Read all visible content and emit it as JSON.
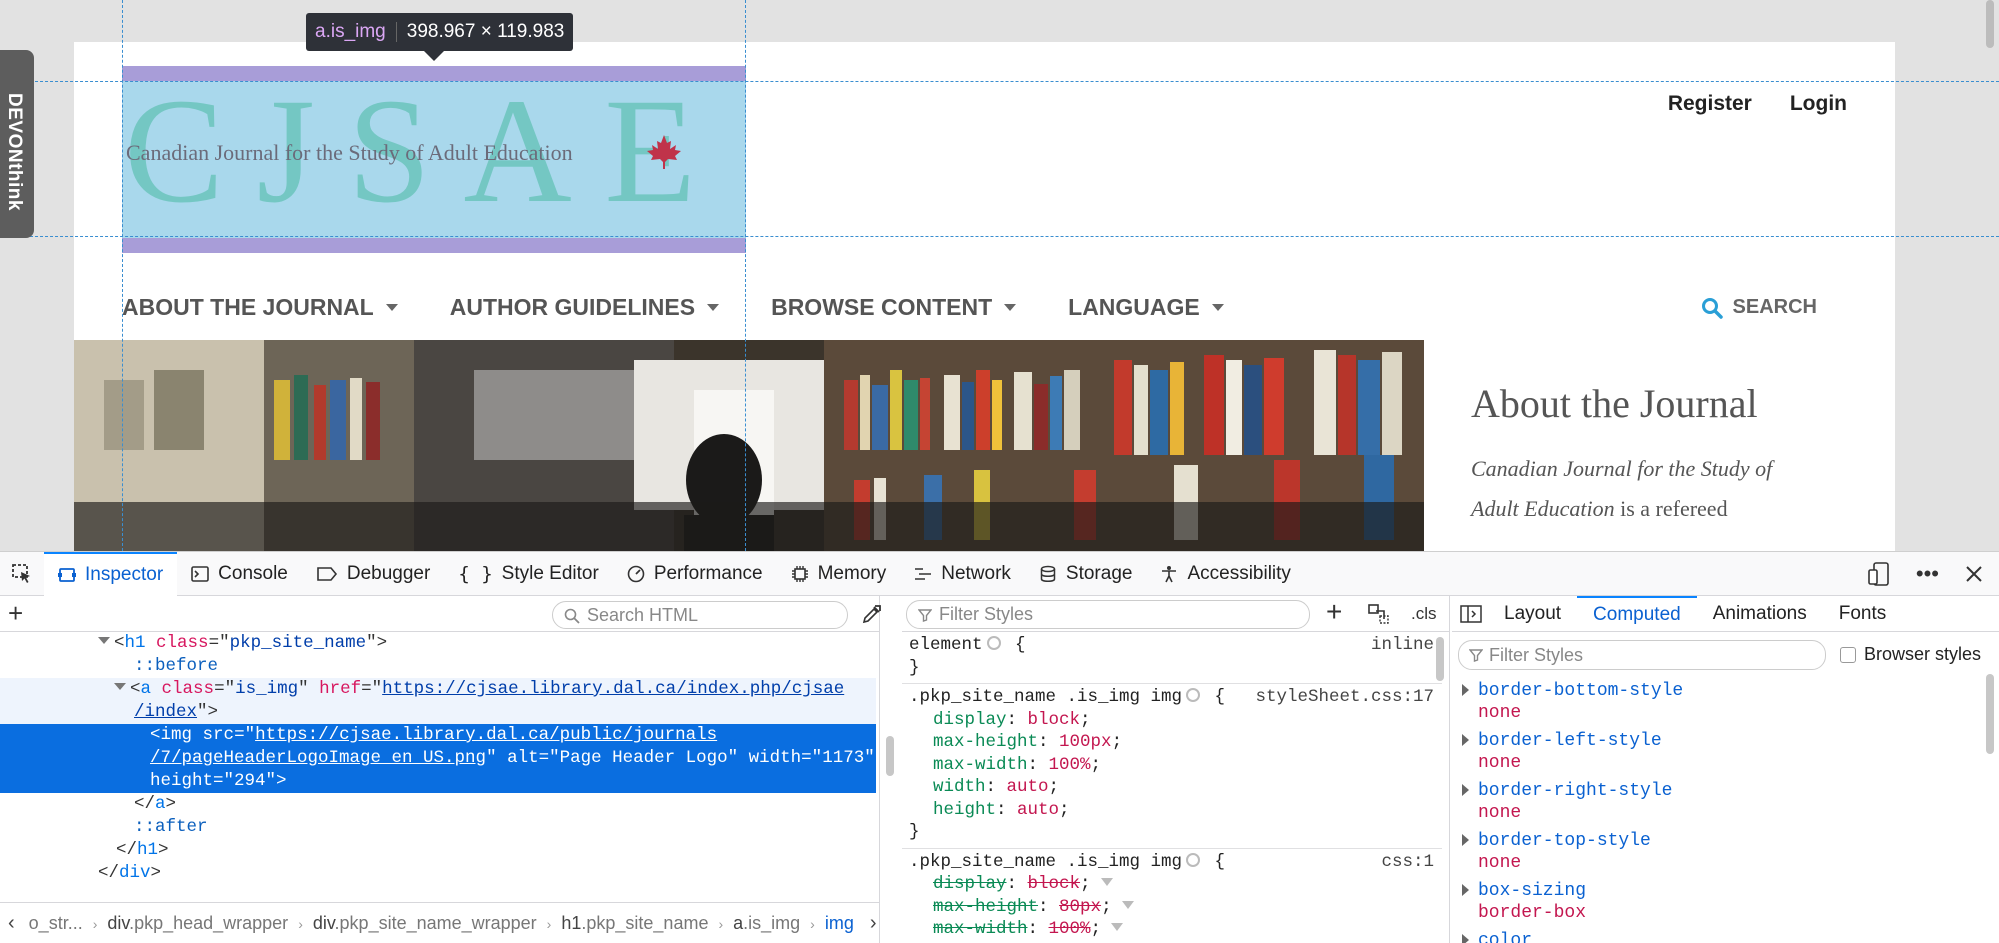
{
  "website": {
    "user_nav": {
      "register": "Register",
      "login": "Login"
    },
    "logo": {
      "letters": [
        "C",
        "J",
        "S",
        "A",
        "E"
      ],
      "tagline": "Canadian Journal for the Study of Adult Education",
      "alt": "Page Header Logo"
    },
    "primary_nav": [
      {
        "label": "ABOUT THE JOURNAL"
      },
      {
        "label": "AUTHOR GUIDELINES"
      },
      {
        "label": "BROWSE CONTENT"
      },
      {
        "label": "LANGUAGE"
      }
    ],
    "search_label": "SEARCH",
    "sidebar": {
      "title": "About the Journal",
      "text_italic_1": "Canadian Journal for the Study of",
      "text_italic_2": "Adult Education",
      "text_rest": " is a refereed"
    }
  },
  "highlighter": {
    "selector_tag": "a.is_img",
    "dimensions": "398.967 × 119.983"
  },
  "devon_tab": "DEVONthink",
  "devtools": {
    "tabs": [
      {
        "label": "Inspector",
        "icon": "inspector-icon"
      },
      {
        "label": "Console",
        "icon": "console-icon"
      },
      {
        "label": "Debugger",
        "icon": "debugger-icon"
      },
      {
        "label": "Style Editor",
        "icon": "style-editor-icon"
      },
      {
        "label": "Performance",
        "icon": "performance-icon"
      },
      {
        "label": "Memory",
        "icon": "memory-icon"
      },
      {
        "label": "Network",
        "icon": "network-icon"
      },
      {
        "label": "Storage",
        "icon": "storage-icon"
      },
      {
        "label": "Accessibility",
        "icon": "accessibility-icon"
      }
    ],
    "markup": {
      "search_placeholder": "Search HTML",
      "h1_open": {
        "tag": "h1",
        "attr": "class",
        "value": "pkp_site_name"
      },
      "before": "::before",
      "a_open": {
        "tag": "a",
        "attr1": "class",
        "val1": "is_img",
        "attr2": "href",
        "href_1": "https://cjsae.library.dal.ca/index.php/cjsae",
        "href_2": "/index"
      },
      "img": {
        "tag": "img",
        "src_attr": "src",
        "src_1": "https://cjsae.library.dal.ca/public/journals",
        "src_2": "/7/pageHeaderLogoImage_en_US.png",
        "alt_attr": "alt",
        "alt_val": "Page Header Logo",
        "width_attr": "width",
        "width_val": "1173",
        "height_attr": "height",
        "height_val": "294"
      },
      "a_close": "a",
      "after": "::after",
      "h1_close": "h1",
      "div_close": "div",
      "breadcrumbs": [
        {
          "tag": "",
          "cls": "o_str..."
        },
        {
          "tag": "div",
          "cls": ".pkp_head_wrapper"
        },
        {
          "tag": "div",
          "cls": ".pkp_site_name_wrapper"
        },
        {
          "tag": "h1",
          "cls": ".pkp_site_name"
        },
        {
          "tag": "a",
          "cls": ".is_img"
        },
        {
          "tag": "img",
          "cls": ""
        }
      ]
    },
    "rules": {
      "filter_placeholder": "Filter Styles",
      "cls_label": ".cls",
      "element_rule": {
        "selector": "element",
        "source": "inline"
      },
      "rule1": {
        "selector": ".pkp_site_name .is_img img",
        "source": "styleSheet.css:17",
        "decls": [
          {
            "prop": "display",
            "val": "block"
          },
          {
            "prop": "max-height",
            "val": "100px"
          },
          {
            "prop": "max-width",
            "val": "100%"
          },
          {
            "prop": "width",
            "val": "auto"
          },
          {
            "prop": "height",
            "val": "auto"
          }
        ]
      },
      "rule2": {
        "selector": ".pkp_site_name .is_img img",
        "source": "css:1",
        "decls": [
          {
            "prop": "display",
            "val": "block"
          },
          {
            "prop": "max-height",
            "val": "80px"
          },
          {
            "prop": "max-width",
            "val": "100%"
          }
        ]
      }
    },
    "side_tabs": [
      "Layout",
      "Computed",
      "Animations",
      "Fonts"
    ],
    "computed": {
      "filter_placeholder": "Filter Styles",
      "browser_styles": "Browser styles",
      "props": [
        {
          "name": "border-bottom-style",
          "value": "none"
        },
        {
          "name": "border-left-style",
          "value": "none"
        },
        {
          "name": "border-right-style",
          "value": "none"
        },
        {
          "name": "border-top-style",
          "value": "none"
        },
        {
          "name": "box-sizing",
          "value": "border-box"
        },
        {
          "name": "color",
          "value": ""
        }
      ]
    }
  },
  "colors": {
    "accent": "#0a84ff",
    "logo_letters": "#74c7c3",
    "highlight_fill": "#a9d8ec",
    "highlight_margin": "#a89dd8",
    "maple_leaf": "#c0334a"
  }
}
